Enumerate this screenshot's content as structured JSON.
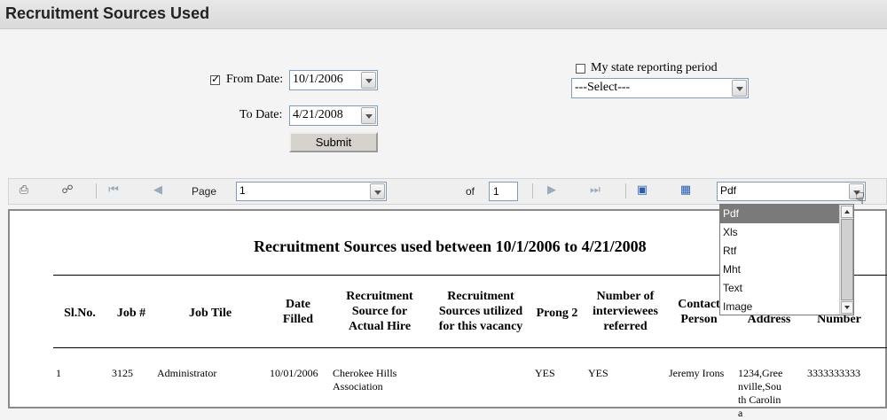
{
  "page": {
    "title": "Recruitment Sources Used"
  },
  "filters": {
    "from_date_label": "From Date:",
    "from_date_value": "10/1/2006",
    "from_date_checked": true,
    "to_date_label": "To Date:",
    "to_date_value": "4/21/2008",
    "submit_label": "Submit",
    "state_period_label": "My state reporting period",
    "state_period_checked": false,
    "state_select_value": "---Select---"
  },
  "toolbar": {
    "page_label": "Page",
    "page_value": "1",
    "of_label": "of",
    "total_pages": "1",
    "export_format": "Pdf",
    "export_options": [
      "Pdf",
      "Xls",
      "Rtf",
      "Mht",
      "Text",
      "Image"
    ],
    "export_selected_index": 0
  },
  "report": {
    "title": "Recruitment Sources used between 10/1/2006 to 4/21/2008",
    "columns": [
      "Sl.No.",
      "Job #",
      "Job Tile",
      "Date Filled",
      "Recruitment Source for Actual Hire",
      "Recruitment Sources utilized for this vacancy",
      "Prong 2",
      "Number of interviewees referred",
      "Contact Person",
      "Address",
      "Number"
    ],
    "rows": [
      {
        "sl_no": "1",
        "job_no": "3125",
        "job_title": "Administrator",
        "date_filled": "10/01/2006",
        "source_actual": "Cherokee Hills Association",
        "sources_utilized": "",
        "prong2": "YES",
        "interviewees": "YES",
        "contact": "Jeremy Irons",
        "address": "1234,Greenville,South Carolina",
        "number": "3333333333"
      }
    ]
  }
}
